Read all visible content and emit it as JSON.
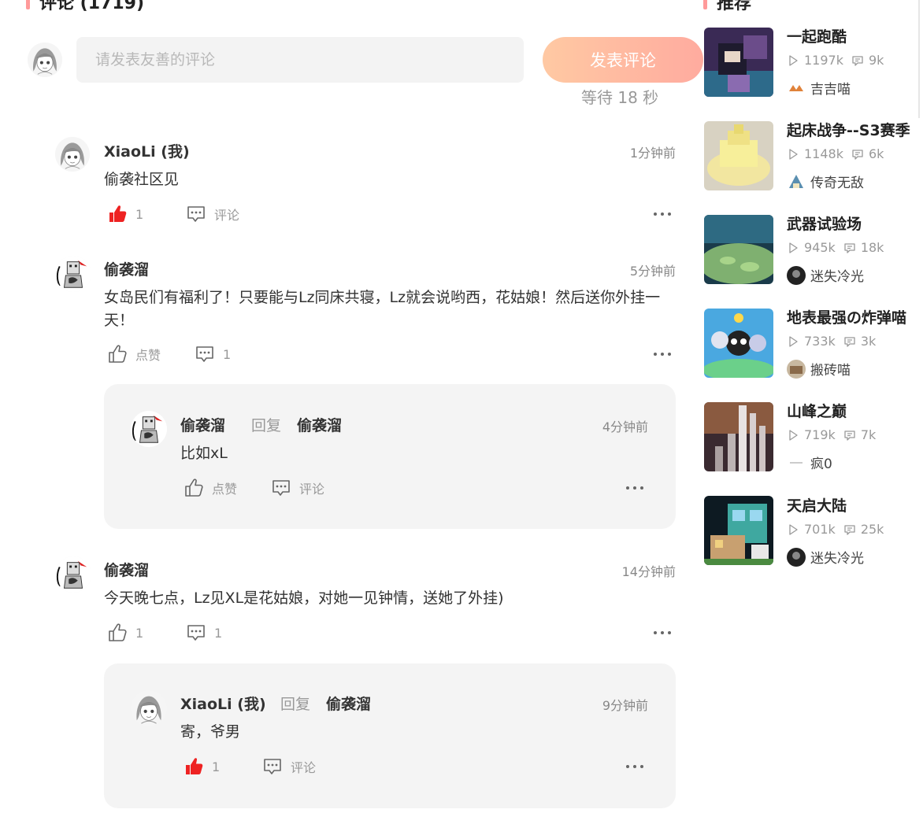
{
  "comments_section": {
    "title": "评论 (1719)"
  },
  "recommend_section": {
    "title": "推荐"
  },
  "composer": {
    "placeholder": "请发表友善的评论",
    "post_label": "发表评论",
    "wait_text": "等待 18 秒"
  },
  "comments": [
    {
      "user": "XiaoLi (我)",
      "time": "1分钟前",
      "text": "偷袭社区见",
      "like_label": "1",
      "liked": true,
      "comment_label": "评论"
    },
    {
      "user": "偷袭溜",
      "time": "5分钟前",
      "text": "女岛民们有福利了！只要能与Lz同床共寝，Lz就会说哟西，花姑娘！然后送你外挂一天！",
      "like_label": "点赞",
      "liked": false,
      "comment_label": "1",
      "reply": {
        "user": "偷袭溜",
        "reply_word": "回复",
        "to": "偷袭溜",
        "time": "4分钟前",
        "text": "比如xL",
        "like_label": "点赞",
        "comment_label": "评论"
      }
    },
    {
      "user": "偷袭溜",
      "time": "14分钟前",
      "text": "今天晚七点，Lz见XL是花姑娘，对她一见钟情，送她了外挂)",
      "like_label": "1",
      "liked": false,
      "comment_label": "1",
      "reply": {
        "user": "XiaoLi (我)",
        "reply_word": "回复",
        "to": "偷袭溜",
        "time": "9分钟前",
        "text": "寄，爷男",
        "like_label": "1",
        "liked": true,
        "comment_label": "评论"
      }
    }
  ],
  "recommendations": [
    {
      "title": "一起跑酷",
      "plays": "1197k",
      "comments": "9k",
      "author": "吉吉喵"
    },
    {
      "title": "起床战争--S3赛季",
      "plays": "1148k",
      "comments": "6k",
      "author": "传奇无敌"
    },
    {
      "title": "武器试验场",
      "plays": "945k",
      "comments": "18k",
      "author": "迷失冷光"
    },
    {
      "title": "地表最强の炸弹喵",
      "plays": "733k",
      "comments": "3k",
      "author": "搬砖喵"
    },
    {
      "title": "山峰之巅",
      "plays": "719k",
      "comments": "7k",
      "author": "疯0"
    },
    {
      "title": "天启大陆",
      "plays": "701k",
      "comments": "25k",
      "author": "迷失冷光"
    }
  ],
  "colors": {
    "like_active": "#ee2222",
    "button_gradient_start": "#ffc9a3",
    "button_gradient_end": "#ffab9f",
    "muted_text": "#999999"
  },
  "icons": {
    "like": "thumbs-up-icon",
    "like_active": "thumbs-up-filled-icon",
    "comment": "comment-bubble-icon",
    "more": "more-dots-icon",
    "play": "play-icon",
    "comment_count": "comment-count-icon"
  }
}
